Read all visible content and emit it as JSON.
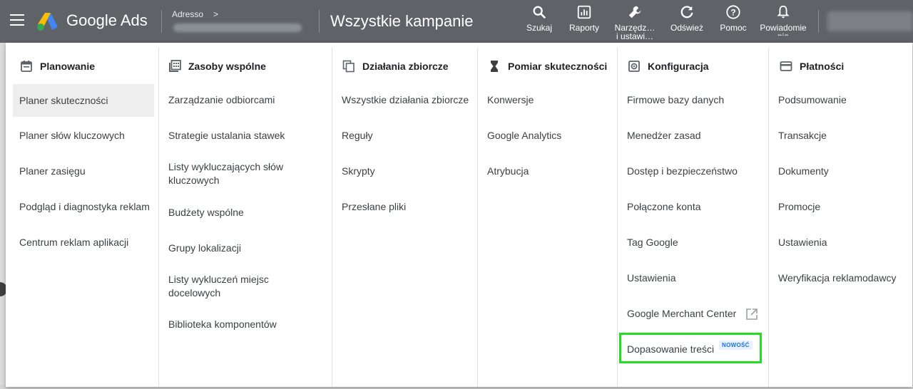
{
  "header": {
    "brand": "Google Ads",
    "account_label": "Adresso",
    "account_chevron": ">",
    "page_title": "Wszystkie kampanie",
    "tools": [
      {
        "label": "Szukaj",
        "icon": "search-icon"
      },
      {
        "label": "Raporty",
        "icon": "reports-icon"
      },
      {
        "label": "Narzędz…\ni ustawi…",
        "icon": "wrench-icon"
      },
      {
        "label": "Odśwież",
        "icon": "refresh-icon"
      },
      {
        "label": "Pomoc",
        "icon": "help-icon"
      },
      {
        "label": "Powiadomie\nnia",
        "icon": "bell-icon"
      }
    ]
  },
  "menu": {
    "columns": [
      {
        "title": "Planowanie",
        "icon": "calendar-icon",
        "items": [
          "Planer skuteczności",
          "Planer słów kluczowych",
          "Planer zasięgu",
          "Podgląd i diagnostyka reklam",
          "Centrum reklam aplikacji"
        ],
        "selected_index": 0
      },
      {
        "title": "Zasoby wspólne",
        "icon": "library-icon",
        "items": [
          "Zarządzanie odbiorcami",
          "Strategie ustalania stawek",
          "Listy wykluczających słów kluczowych",
          "Budżety wspólne",
          "Grupy lokalizacji",
          "Listy wykluczeń miejsc docelowych",
          "Biblioteka komponentów"
        ]
      },
      {
        "title": "Działania zbiorcze",
        "icon": "copy-icon",
        "items": [
          "Wszystkie działania zbiorcze",
          "Reguły",
          "Skrypty",
          "Przesłane pliki"
        ]
      },
      {
        "title": "Pomiar skuteczności",
        "icon": "hourglass-icon",
        "items": [
          "Konwersje",
          "Google Analytics",
          "Atrybucja"
        ]
      },
      {
        "title": "Konfiguracja",
        "icon": "settings-icon",
        "items": [
          "Firmowe bazy danych",
          "Menedżer zasad",
          "Dostęp i bezpieczeństwo",
          "Połączone konta",
          "Tag Google",
          "Ustawienia",
          "Google Merchant Center",
          "Dopasowanie treści"
        ],
        "external_link_item": "Google Merchant Center",
        "new_badge_label": "NOWOŚĆ",
        "highlighted_item": "Dopasowanie treści",
        "highlight_color": "#22dd22"
      },
      {
        "title": "Płatności",
        "icon": "credit-card-icon",
        "items": [
          "Podsumowanie",
          "Transakcje",
          "Dokumenty",
          "Promocje",
          "Ustawienia",
          "Weryfikacja reklamodawcy"
        ]
      }
    ]
  },
  "colors": {
    "header_bg": "#5f6368",
    "selected_bg": "#eeeeee",
    "badge_text": "#1a73e8",
    "badge_bg": "#e8f0fe"
  }
}
